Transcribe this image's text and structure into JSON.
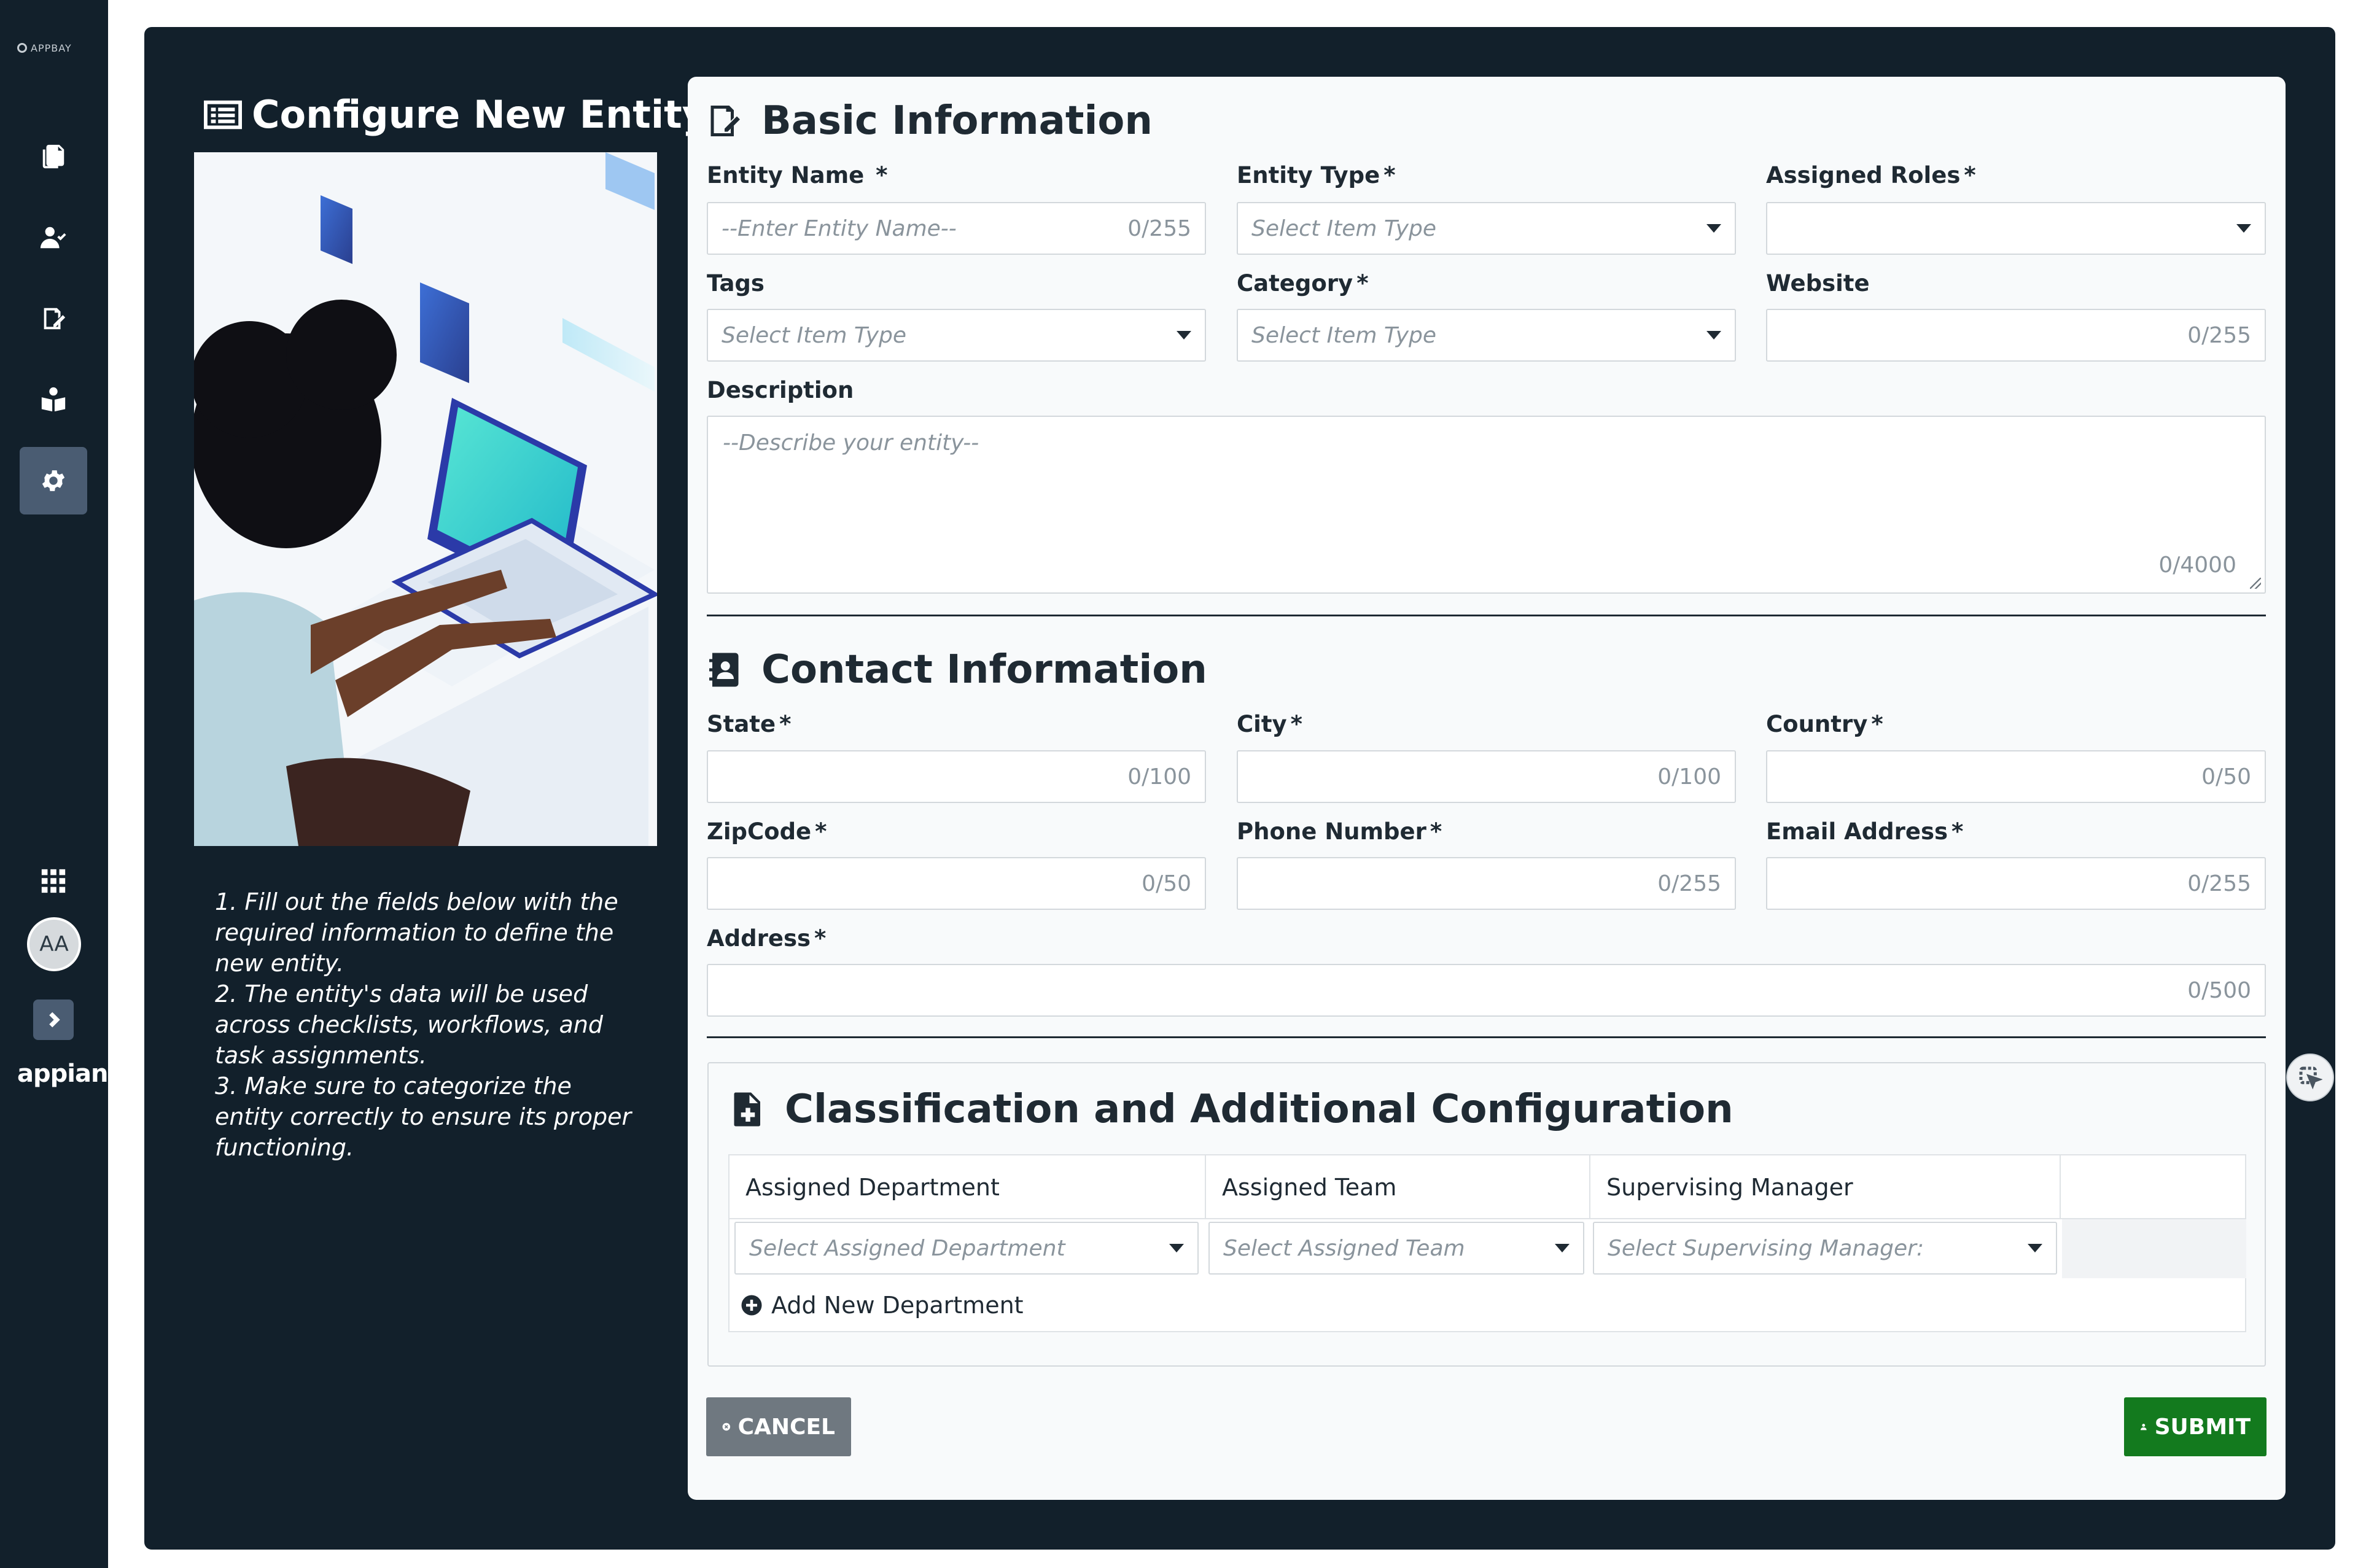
{
  "rail": {
    "logo_text": "APPBAY",
    "nav_icons": [
      "documents-icon",
      "user-check-icon",
      "edit-document-icon",
      "reader-icon",
      "settings-icon"
    ],
    "active_item": "settings-icon",
    "apps_icon": "grid-icon",
    "avatar_initials": "AA",
    "expand_icon": "chevron-right-icon",
    "brand": "appian"
  },
  "info": {
    "title": "Configure New Entity",
    "instructions": [
      "1. Fill out the fields below with the required information to define the new entity.",
      "2. The entity's data will be used across checklists, workflows, and task assignments.",
      "3. Make sure to categorize the entity correctly to ensure its proper functioning."
    ]
  },
  "basic": {
    "title": "Basic Information",
    "entity_name": {
      "label": "Entity Name",
      "required": "*",
      "placeholder": "--Enter Entity Name--",
      "count": "0/255"
    },
    "entity_type": {
      "label": "Entity Type",
      "required": "*",
      "placeholder": "Select Item Type"
    },
    "assigned_roles": {
      "label": "Assigned Roles",
      "required": "*",
      "placeholder": ""
    },
    "tags": {
      "label": "Tags",
      "placeholder": "Select Item Type"
    },
    "category": {
      "label": "Category",
      "required": "*",
      "placeholder": "Select Item Type"
    },
    "website": {
      "label": "Website",
      "count": "0/255"
    },
    "description": {
      "label": "Description",
      "placeholder": "--Describe your entity--",
      "count": "0/4000"
    }
  },
  "contact": {
    "title": "Contact Information",
    "state": {
      "label": "State",
      "required": "*",
      "count": "0/100"
    },
    "city": {
      "label": "City",
      "required": "*",
      "count": "0/100"
    },
    "country": {
      "label": "Country",
      "required": "*",
      "count": "0/50"
    },
    "zipcode": {
      "label": "ZipCode",
      "required": "*",
      "count": "0/50"
    },
    "phone": {
      "label": "Phone Number",
      "required": "*",
      "count": "0/255"
    },
    "email": {
      "label": "Email Address",
      "required": "*",
      "count": "0/255"
    },
    "address": {
      "label": "Address",
      "required": "*",
      "count": "0/500"
    }
  },
  "classification": {
    "title": "Classification and Additional Configuration",
    "columns": [
      "Assigned Department",
      "Assigned Team",
      "Supervising Manager"
    ],
    "row": {
      "department_placeholder": "Select Assigned Department",
      "team_placeholder": "Select Assigned Team",
      "manager_placeholder": "Select Supervising Manager:"
    },
    "add_label": "Add New Department"
  },
  "actions": {
    "cancel_label": "CANCEL",
    "submit_label": "SUBMIT"
  },
  "colors": {
    "rail_bg": "#12202b",
    "frame_bg": "#12202b",
    "active_nav": "#4a5c72",
    "cancel_bg": "#6f7880",
    "submit_bg": "#137a1e"
  }
}
